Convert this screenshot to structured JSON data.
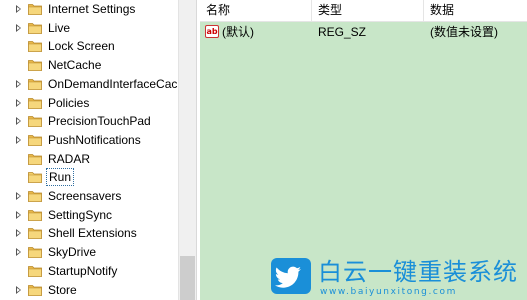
{
  "tree": {
    "items": [
      {
        "label": "Internet Settings",
        "expandable": true
      },
      {
        "label": "Live",
        "expandable": true
      },
      {
        "label": "Lock Screen",
        "expandable": false
      },
      {
        "label": "NetCache",
        "expandable": false
      },
      {
        "label": "OnDemandInterfaceCac",
        "expandable": true
      },
      {
        "label": "Policies",
        "expandable": true
      },
      {
        "label": "PrecisionTouchPad",
        "expandable": true
      },
      {
        "label": "PushNotifications",
        "expandable": true
      },
      {
        "label": "RADAR",
        "expandable": false
      },
      {
        "label": "Run",
        "expandable": false,
        "selected": true
      },
      {
        "label": "Screensavers",
        "expandable": true
      },
      {
        "label": "SettingSync",
        "expandable": true
      },
      {
        "label": "Shell Extensions",
        "expandable": true
      },
      {
        "label": "SkyDrive",
        "expandable": true
      },
      {
        "label": "StartupNotify",
        "expandable": false
      },
      {
        "label": "Store",
        "expandable": true
      }
    ]
  },
  "values": {
    "columns": {
      "name": "名称",
      "type": "类型",
      "data": "数据"
    },
    "rows": [
      {
        "icon": "ab",
        "name": "(默认)",
        "type": "REG_SZ",
        "data": "(数值未设置)"
      }
    ]
  },
  "watermark": {
    "title": "白云一键重装系统",
    "url": "www.baiyunxitong.com"
  },
  "colors": {
    "values_background": "#c8e6c8",
    "folder": "#e8b84a",
    "watermark": "#1a8fd8"
  }
}
